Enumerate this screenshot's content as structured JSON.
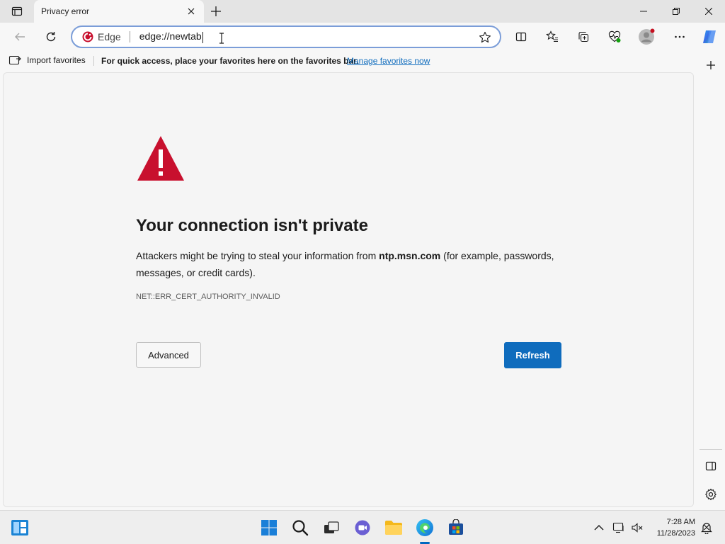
{
  "tab": {
    "title": "Privacy error"
  },
  "omnibox": {
    "site_label": "Edge",
    "url": "edge://newtab"
  },
  "favorites_bar": {
    "import_label": "Import favorites",
    "message": "For quick access, place your favorites here on the favorites bar.",
    "manage_link": "Manage favorites now"
  },
  "page": {
    "heading": "Your connection isn't private",
    "message_prefix": "Attackers might be trying to steal your information from ",
    "message_host": "ntp.msn.com",
    "message_suffix": " (for example, passwords, messages, or credit cards).",
    "error_code": "NET::ERR_CERT_AUTHORITY_INVALID",
    "advanced_label": "Advanced",
    "refresh_label": "Refresh"
  },
  "taskbar": {
    "time": "7:28 AM",
    "date": "11/28/2023"
  },
  "colors": {
    "accent": "#0f6cbd",
    "warning_red": "#c8102e"
  }
}
